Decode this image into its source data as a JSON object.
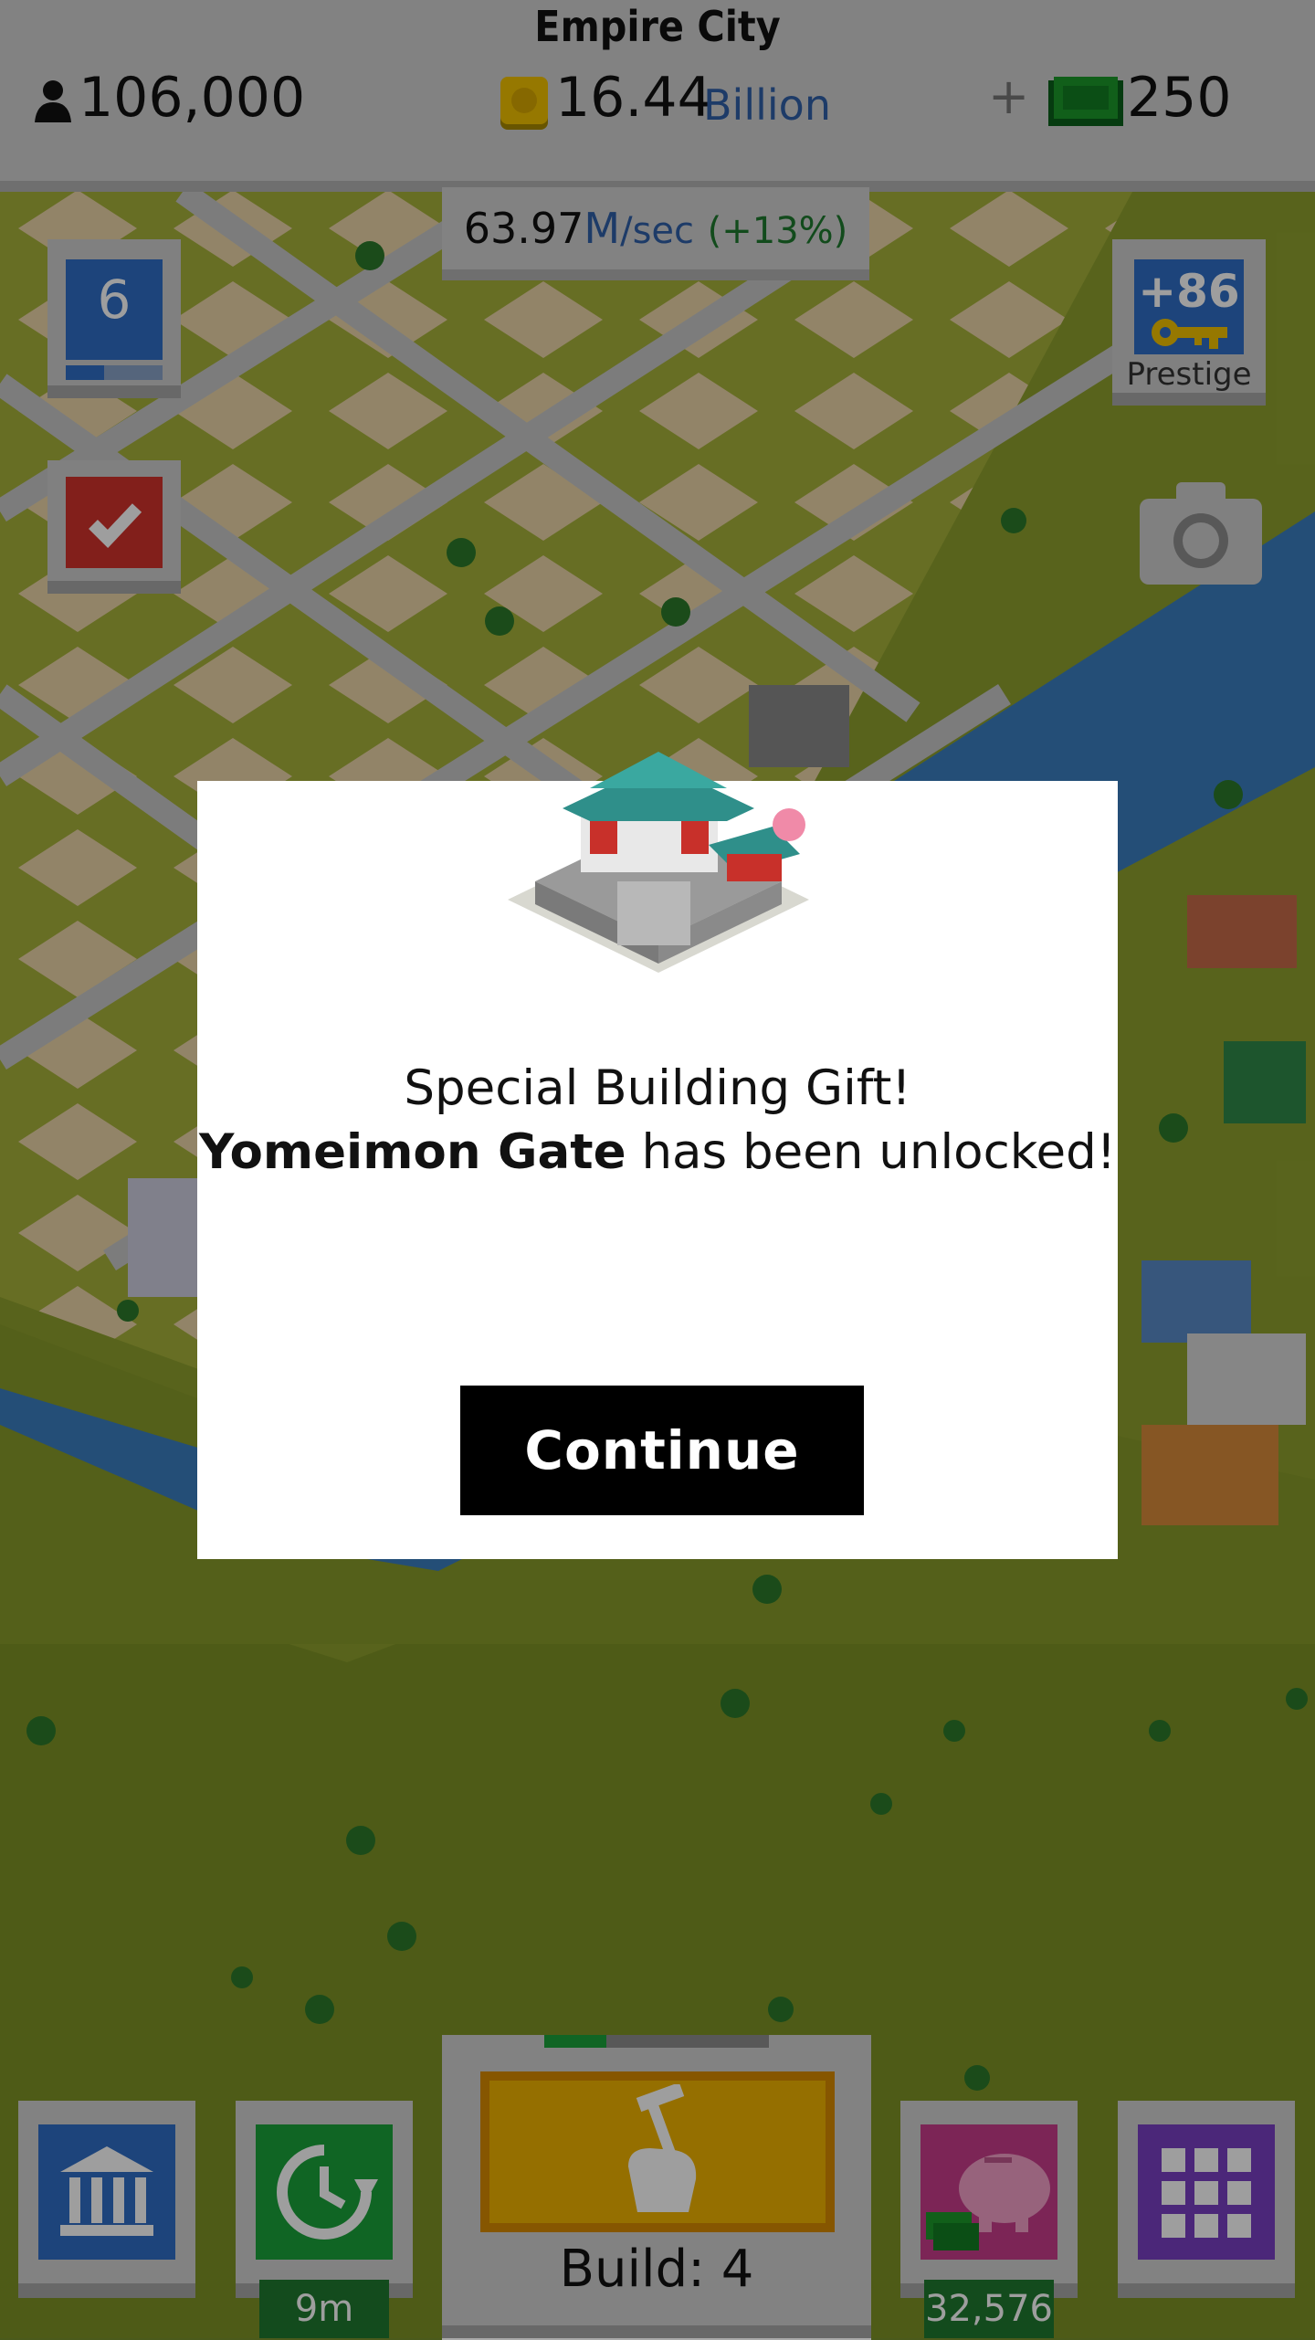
{
  "header": {
    "city_name": "Empire City",
    "population": "106,000",
    "coins_value": "16.44",
    "coins_unit": "Billion",
    "plus_label": "+",
    "cash": "250"
  },
  "income": {
    "value": "63.97",
    "unit": "M",
    "per": "/sec",
    "bonus": "(+13%)"
  },
  "level": {
    "number": "6",
    "progress": 0.4
  },
  "prestige": {
    "value": "+86",
    "label": "Prestige"
  },
  "dialog": {
    "line1": "Special Building Gift!",
    "building_name": "Yomeimon Gate",
    "line2_suffix": "has been unlocked!",
    "continue_label": "Continue"
  },
  "bottom": {
    "timer_label": "9m",
    "build_label": "Build: 4",
    "bank_amount": "32,576"
  },
  "icons": [
    "person-icon",
    "coin-icon",
    "cash-icon",
    "museum-icon",
    "clock-refresh-icon",
    "hammer-hand-icon",
    "piggy-bank-icon",
    "grid-menu-icon",
    "checkmark-icon",
    "key-icon",
    "camera-icon"
  ],
  "colors": {
    "level_blue": "#2f6fc7",
    "check_red": "#d2322d",
    "build_yellow": "#f0b400",
    "timer_green": "#1aa33a",
    "piggy_magenta": "#c83c8c",
    "grid_purple": "#7a3fc4",
    "modal_bg": "#ffffff",
    "button_bg": "#000000"
  }
}
